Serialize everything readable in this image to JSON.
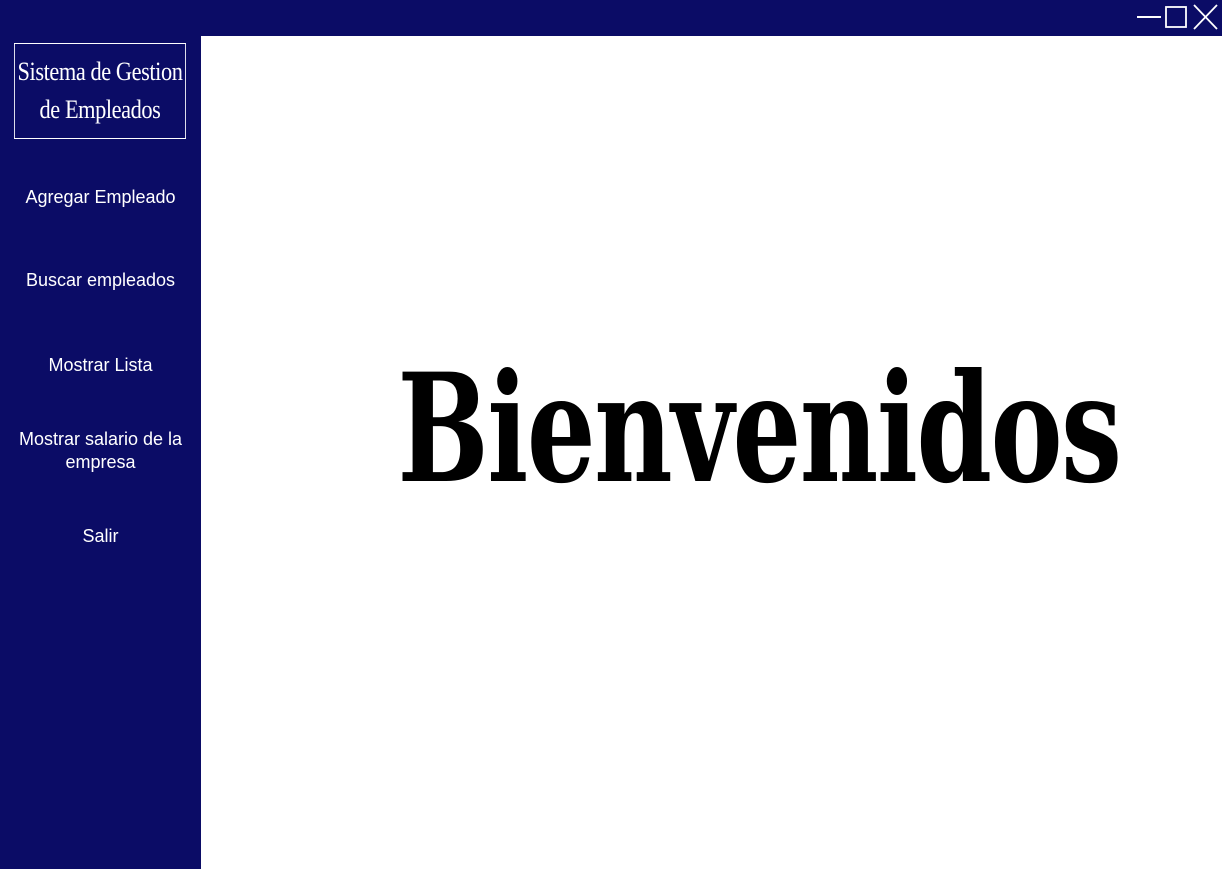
{
  "app": {
    "brand_title": "Sistema de Gestion de Empleados"
  },
  "window_controls": {
    "minimize": "minimize-icon",
    "maximize": "maximize-icon",
    "close": "close-icon"
  },
  "sidebar": {
    "items": [
      {
        "label": "Agregar Empleado"
      },
      {
        "label": "Buscar empleados"
      },
      {
        "label": "Mostrar Lista"
      },
      {
        "label": "Mostrar salario de la empresa"
      },
      {
        "label": "Salir"
      }
    ]
  },
  "main": {
    "welcome_text": "Bienvenidos"
  },
  "colors": {
    "sidebar_bg": "#0b0c66",
    "main_bg": "#ffffff",
    "text_light": "#ffffff",
    "text_dark": "#000000"
  }
}
